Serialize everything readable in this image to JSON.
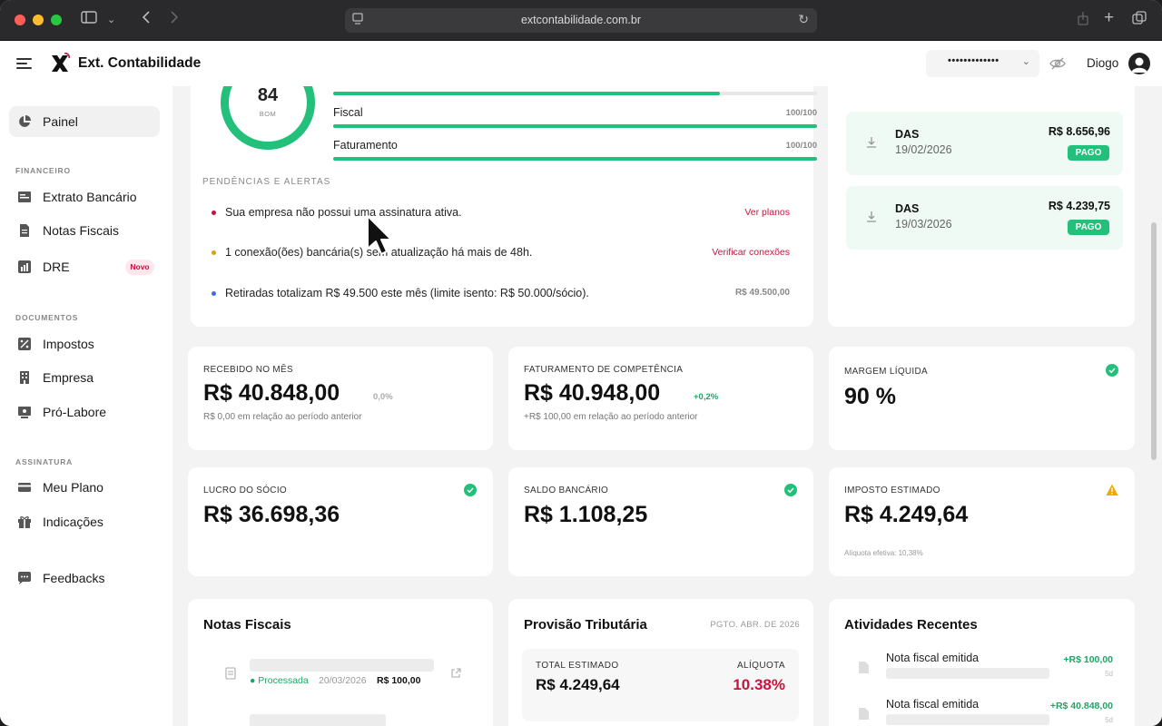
{
  "browser": {
    "url": "extcontabilidade.com.br"
  },
  "header": {
    "brand": "Ext. Contabilidade",
    "masked_value": "•••••••••••••",
    "user_name": "Diogo"
  },
  "sidebar": {
    "items": [
      {
        "label": "Painel",
        "icon": "pie-chart-icon"
      },
      {
        "label": "Extrato Bancário",
        "icon": "bank-statement-icon"
      },
      {
        "label": "Notas Fiscais",
        "icon": "invoice-icon"
      },
      {
        "label": "DRE",
        "icon": "bar-chart-icon",
        "badge": "Novo"
      },
      {
        "label": "Impostos",
        "icon": "percent-icon"
      },
      {
        "label": "Empresa",
        "icon": "building-icon"
      },
      {
        "label": "Pró-Labore",
        "icon": "id-card-icon"
      },
      {
        "label": "Meu Plano",
        "icon": "credit-card-icon"
      },
      {
        "label": "Indicações",
        "icon": "gift-icon"
      },
      {
        "label": "Feedbacks",
        "icon": "chat-icon"
      }
    ],
    "sections": {
      "financeiro": "FINANCEIRO",
      "documentos": "DOCUMENTOS",
      "assinatura": "ASSINATURA"
    }
  },
  "health": {
    "score": "84",
    "score_label": "BOM",
    "bars": [
      {
        "label": "",
        "value": "",
        "fill_percent": 80
      },
      {
        "label": "Fiscal",
        "value": "100/100",
        "fill_percent": 100
      },
      {
        "label": "Faturamento",
        "value": "100/100",
        "fill_percent": 100
      }
    ],
    "alerts_title": "PENDÊNCIAS E ALERTAS",
    "alerts": [
      {
        "text": "Sua empresa não possui uma assinatura ativa.",
        "action": "Ver planos",
        "color": "#c8143c"
      },
      {
        "text": "1 conexão(ões) bancária(s) sem atualização há mais de 48h.",
        "action": "Verificar conexões",
        "color": "#e0a000"
      },
      {
        "text": "Retiradas totalizam R$ 49.500 este mês (limite isento: R$ 50.000/sócio).",
        "amount": "R$ 49.500,00",
        "color": "#3b6fe0"
      }
    ]
  },
  "das": [
    {
      "title": "DAS",
      "date": "19/02/2026",
      "amount": "R$ 8.656,96",
      "status": "PAGO"
    },
    {
      "title": "DAS",
      "date": "19/03/2026",
      "amount": "R$ 4.239,75",
      "status": "PAGO"
    }
  ],
  "metrics": {
    "recebido": {
      "title": "RECEBIDO NO MÊS",
      "value": "R$ 40.848,00",
      "delta": "0,0%",
      "sub": "R$ 0,00 em relação ao período anterior"
    },
    "faturamento": {
      "title": "FATURAMENTO DE COMPETÊNCIA",
      "value": "R$ 40.948,00",
      "delta": "+0,2%",
      "sub": "+R$ 100,00 em relação ao período anterior"
    },
    "margem": {
      "title": "MARGEM LÍQUIDA",
      "value": "90 %"
    },
    "lucro": {
      "title": "LUCRO DO SÓCIO",
      "value": "R$ 36.698,36"
    },
    "saldo": {
      "title": "SALDO BANCÁRIO",
      "value": "R$ 1.108,25"
    },
    "imposto": {
      "title": "IMPOSTO ESTIMADO",
      "value": "R$ 4.249,64",
      "sub": "Alíquota efetiva: 10,38%"
    }
  },
  "notas": {
    "title": "Notas Fiscais",
    "rows": [
      {
        "status": "Processada",
        "date": "20/03/2026",
        "amount": "R$ 100,00"
      }
    ]
  },
  "provisao": {
    "title": "Provisão Tributária",
    "meta": "PGTO. ABR. DE 2026",
    "total_label": "TOTAL ESTIMADO",
    "total_value": "R$ 4.249,64",
    "rate_label": "ALÍQUOTA",
    "rate_value": "10.38%"
  },
  "atividades": {
    "title": "Atividades Recentes",
    "items": [
      {
        "title": "Nota fiscal emitida",
        "amount": "+R$ 100,00",
        "time": "5d"
      },
      {
        "title": "Nota fiscal emitida",
        "amount": "+R$ 40.848,00",
        "time": "5d"
      }
    ]
  },
  "colors": {
    "accent_green": "#22c07a",
    "alert_red": "#c8143c",
    "warning": "#f2a900"
  }
}
